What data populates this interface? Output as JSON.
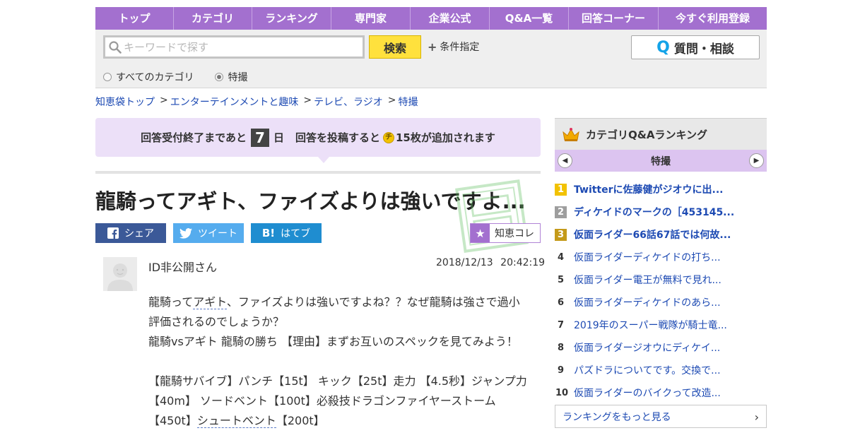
{
  "nav": {
    "items": [
      "トップ",
      "カテゴリ",
      "ランキング",
      "専門家",
      "企業公式",
      "Q&A一覧",
      "回答コーナー",
      "今すぐ利用登録"
    ]
  },
  "search": {
    "placeholder": "キーワードで探す",
    "button_label": "検索",
    "condition_label": "条件指定",
    "ask_button_label": "質問・相談",
    "ask_button_glyph": "Q",
    "radios": [
      {
        "label": "すべてのカテゴリ",
        "selected": false
      },
      {
        "label": "特撮",
        "selected": true
      }
    ]
  },
  "breadcrumb": {
    "separator": ">",
    "items": [
      "知恵袋トップ",
      "エンターテインメントと趣味",
      "テレビ、ラジオ",
      "特撮"
    ]
  },
  "banner": {
    "prefix": "回答受付終了まであと",
    "days": "7",
    "days_unit": "日",
    "middle": "回答を投稿すると",
    "coin_glyph": "チ",
    "suffix": "15枚が追加されます"
  },
  "question": {
    "title": "龍騎ってアギト、ファイズよりは強いですよ...",
    "author": "ID非公開さん",
    "date": "2018/12/13",
    "time": "20:42:19",
    "body": {
      "l1_a": "龍騎って",
      "l1_kw": "アギト",
      "l1_b": "、ファイズよりは強いですよね？？なぜ龍騎は強さで過小評価されるのでしょうか？",
      "l2": "龍騎vsアギト 龍騎の勝ち 【理由】まずお互いのスペックを見てみよう！",
      "l3_a": "【龍騎サバイブ】パンチ【15t】 キック【25t】走力 【4.5秒】ジャンプ力【40m】 ソードベント【100t】必殺技ドラゴンファイヤーストーム【450t】",
      "l3_kw": "シュートベント",
      "l3_b": "【200t】"
    }
  },
  "share": {
    "facebook": "シェア",
    "twitter": "ツイート",
    "hatena": "はてブ",
    "hatena_glyph": "B!",
    "chie_collection": "知恵コレ"
  },
  "ranking": {
    "title": "カテゴリQ&Aランキング",
    "category": "特撮",
    "items": [
      {
        "rank": "1",
        "title": "Twitterに佐藤健がジオウに出..."
      },
      {
        "rank": "2",
        "title": "ディケイドのマークの［453145..."
      },
      {
        "rank": "3",
        "title": "仮面ライダー66話67話では何故..."
      },
      {
        "rank": "4",
        "title": "仮面ライダーディケイドの打ち..."
      },
      {
        "rank": "5",
        "title": "仮面ライダー電王が無料で見れ..."
      },
      {
        "rank": "6",
        "title": "仮面ライダーディケイドのあら..."
      },
      {
        "rank": "7",
        "title": "2019年のスーパー戦隊が騎士竜..."
      },
      {
        "rank": "8",
        "title": "仮面ライダージオウにディケイ..."
      },
      {
        "rank": "9",
        "title": "パズドラについてです。交換で..."
      },
      {
        "rank": "10",
        "title": "仮面ライダーのバイクって改造..."
      }
    ],
    "more_label": "ランキングをもっと見る"
  },
  "colors": {
    "nav_purple": "#a370cf",
    "banner_lavender": "#ece0f8",
    "search_yellow": "#ffe13d",
    "link_blue": "#1d4ab3",
    "facebook": "#3b5998",
    "twitter": "#55acee",
    "hatena": "#1f8dd0"
  }
}
